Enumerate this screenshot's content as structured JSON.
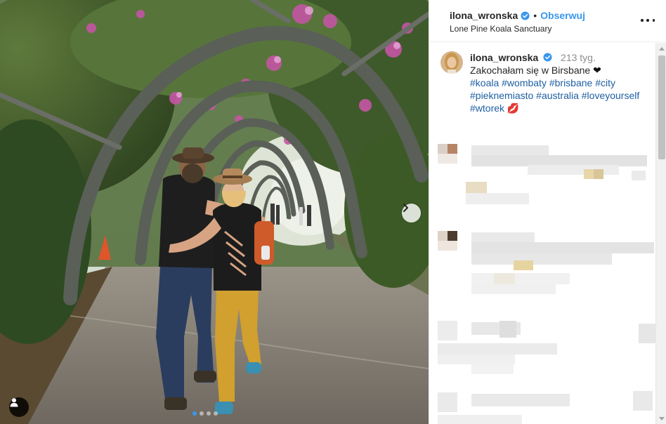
{
  "post": {
    "username": "ilona_wronska",
    "separator": "•",
    "follow_label": "Obserwuj",
    "location": "Lone Pine Koala Sanctuary",
    "more_icon": "more-options-icon"
  },
  "caption": {
    "username": "ilona_wronska",
    "age": "213 tyg.",
    "text": "Zakochałam się w Birsbane",
    "heart": "❤",
    "hashtags_line1": "#koala #wombaty #brisbane #city",
    "hashtags_line2": "#pieknemiasto #australia #loveyourself",
    "hashtags_line3": "#wtorek",
    "lips": "💋"
  },
  "carousel": {
    "slide_count": 4,
    "active_index": 0
  },
  "colors": {
    "accent": "#3897f0",
    "link": "#1f5fa3",
    "verified": "#3897f0",
    "text": "#262626",
    "muted": "#8e8e8e"
  }
}
